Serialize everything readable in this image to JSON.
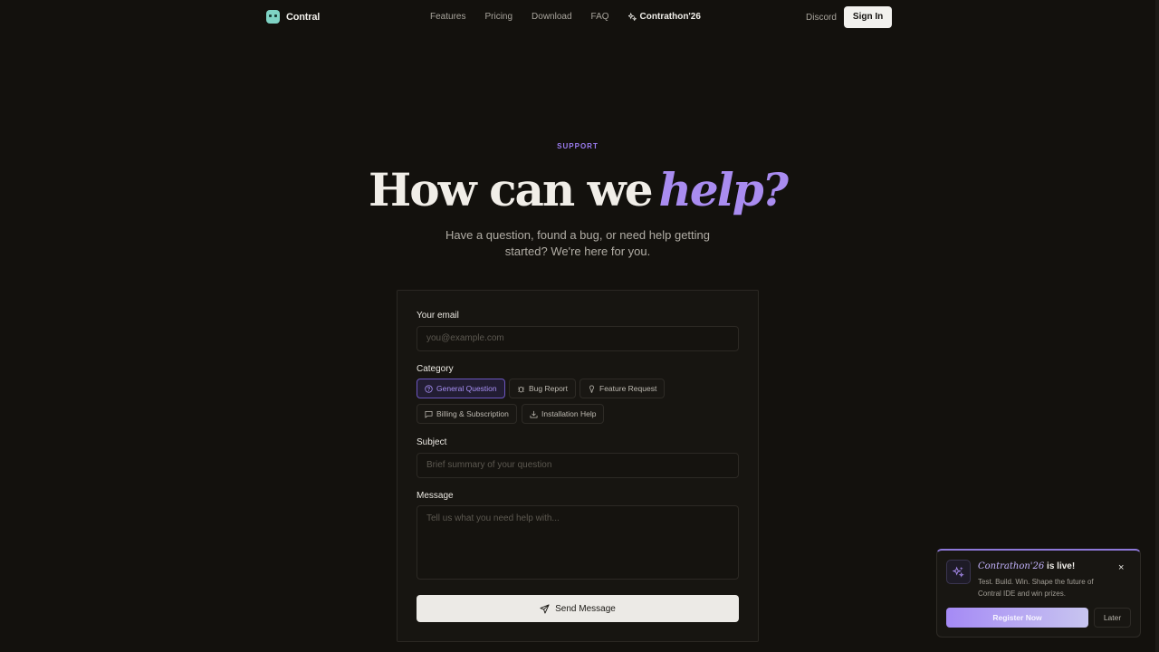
{
  "nav": {
    "brand": "Contral",
    "links": [
      "Features",
      "Pricing",
      "Download",
      "FAQ"
    ],
    "special": "Contrathon'26",
    "discord": "Discord",
    "signin": "Sign In"
  },
  "hero": {
    "eyebrow": "SUPPORT",
    "title_main": "How can we",
    "title_accent": "help?",
    "subtitle": "Have a question, found a bug, or need help getting started? We're here for you."
  },
  "form": {
    "email_label": "Your email",
    "email_placeholder": "you@example.com",
    "category_label": "Category",
    "categories": [
      "General Question",
      "Bug Report",
      "Feature Request",
      "Billing & Subscription",
      "Installation Help"
    ],
    "selected_category": "General Question",
    "subject_label": "Subject",
    "subject_placeholder": "Brief summary of your question",
    "message_label": "Message",
    "message_placeholder": "Tell us what you need help with...",
    "send_label": "Send Message"
  },
  "toast": {
    "title_accent": "Contrathon'26",
    "title_rest": " is live!",
    "text": "Test. Build. Win. Shape the future of Contral IDE and win prizes.",
    "register": "Register Now",
    "later": "Later",
    "close": "×"
  },
  "colors": {
    "background": "#13110d",
    "accent": "#a98cf0"
  }
}
